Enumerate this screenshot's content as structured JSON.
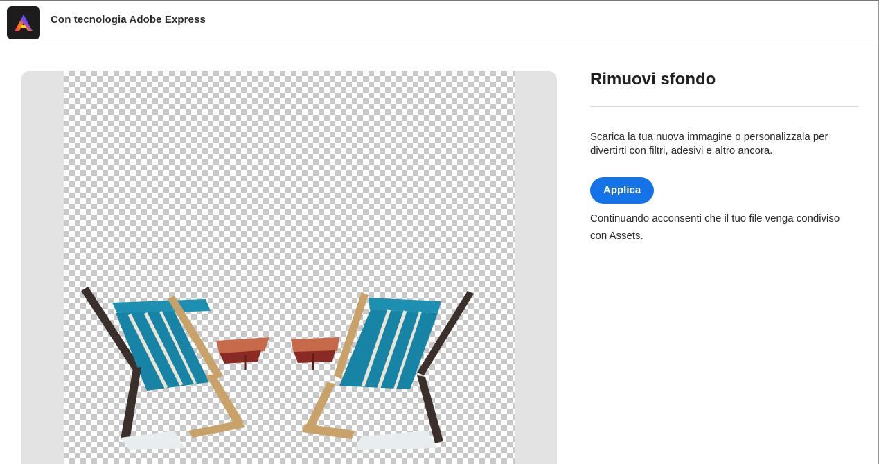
{
  "header": {
    "logo_icon": "adobe-express-logo-icon",
    "title": "Con tecnologia Adobe Express"
  },
  "preview": {
    "image_subject": "two-beach-chairs-cutout"
  },
  "side_panel": {
    "title": "Rimuovi sfondo",
    "description": "Scarica la tua nuova immagine o personalizzala per divertirti con filtri, adesivi e altro ancora.",
    "apply_label": "Applica",
    "consent_text": "Continuando acconsenti che il tuo file venga condiviso con Assets."
  },
  "colors": {
    "accent": "#1473e6",
    "panel_bg": "#e3e3e3"
  }
}
